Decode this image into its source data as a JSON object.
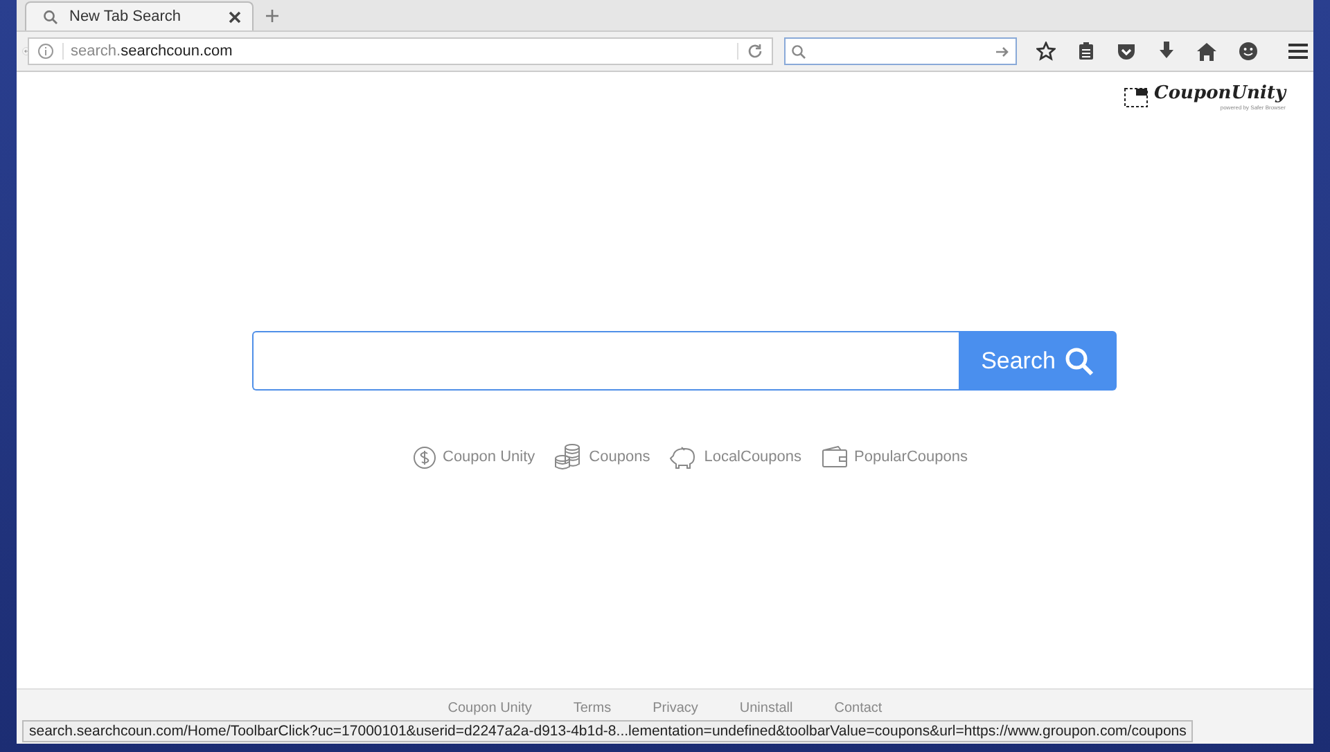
{
  "tabs": [
    {
      "title": "New Tab Search",
      "selected": true
    }
  ],
  "address_bar": {
    "prefix": "search.",
    "domain": "searchcoun.com"
  },
  "logo": {
    "name": "CouponUnity",
    "tagline": "powered by Safer Browser"
  },
  "search": {
    "button": "Search"
  },
  "quick_links": [
    {
      "kind": "dollar",
      "label": "Coupon Unity"
    },
    {
      "kind": "coins",
      "label": "Coupons"
    },
    {
      "kind": "piggy",
      "label": "LocalCoupons"
    },
    {
      "kind": "wallet",
      "label": "PopularCoupons"
    }
  ],
  "footer_links": [
    "Coupon Unity",
    "Terms",
    "Privacy",
    "Uninstall",
    "Contact"
  ],
  "status_bar": "search.searchcoun.com/Home/ToolbarClick?uc=17000101&userid=d2247a2a-d913-4b1d-8...lementation=undefined&toolbarValue=coupons&url=https://www.groupon.com/coupons"
}
